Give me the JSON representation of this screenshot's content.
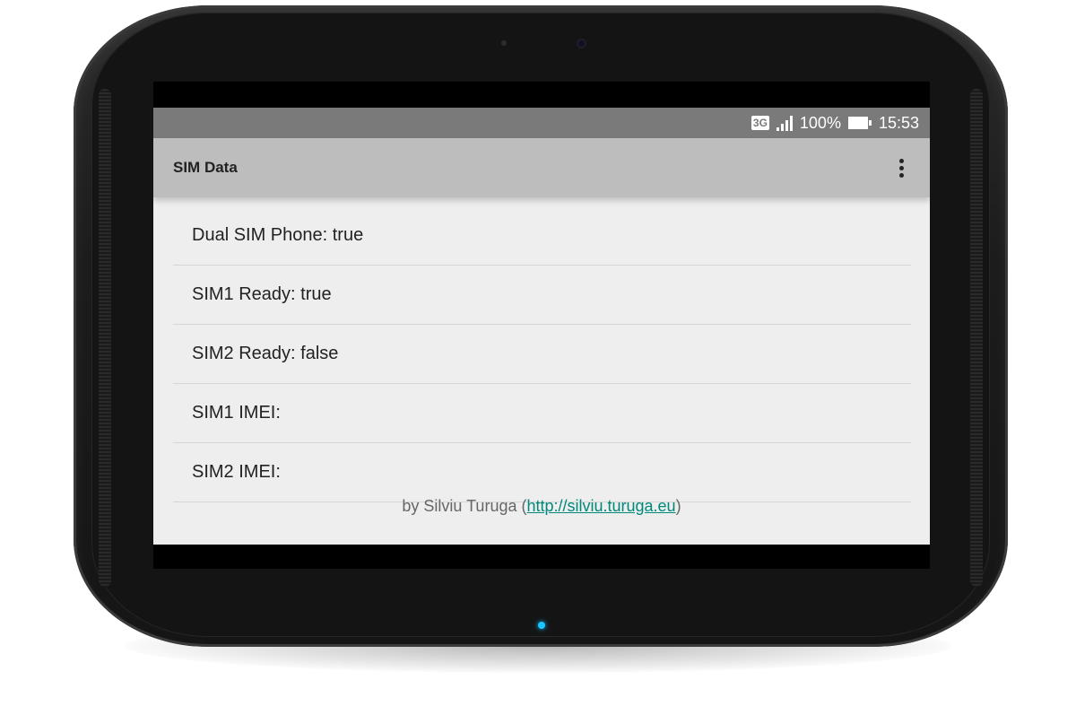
{
  "status_bar": {
    "network_type": "3G",
    "battery_percent": "100%",
    "time": "15:53",
    "icons": [
      "3g-icon",
      "signal-icon",
      "battery-icon"
    ]
  },
  "app_bar": {
    "title": "SIM Data",
    "menu_icon": "more-vert-icon"
  },
  "list": {
    "items": [
      {
        "label": "Dual SIM Phone: true"
      },
      {
        "label": "SIM1 Ready: true"
      },
      {
        "label": "SIM2 Ready: false"
      },
      {
        "label": "SIM1 IMEI:"
      },
      {
        "label": "SIM2 IMEI:"
      }
    ]
  },
  "footer": {
    "prefix": "by Silviu Turuga (",
    "link_text": "http://silviu.turuga.eu",
    "suffix": ")"
  },
  "colors": {
    "status_bar_bg": "#7a7a7a",
    "app_bar_bg": "#bdbdbd",
    "content_bg": "#eeeeee",
    "link": "#00897b",
    "device_body": "#1c1c1c",
    "led": "#19c6ff"
  }
}
